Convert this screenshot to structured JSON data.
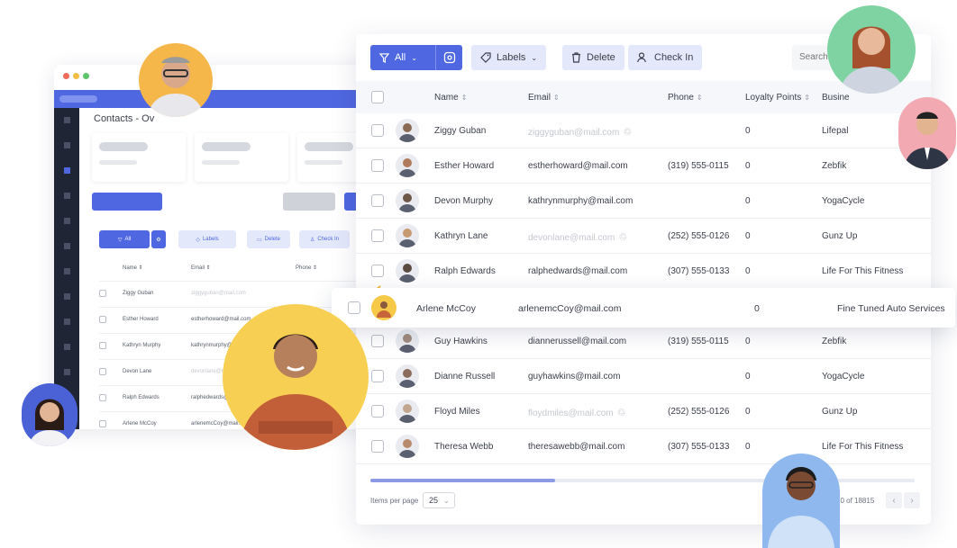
{
  "back_window": {
    "title": "Contacts - Ov",
    "toolbar": {
      "all_label": "All",
      "labels_label": "Labels",
      "delete_label": "Delete",
      "checkin_label": "Check In"
    },
    "headers": {
      "name": "Name",
      "email": "Email",
      "phone": "Phone"
    },
    "rows": [
      {
        "name": "Ziggy Guban",
        "email": "ziggyguban@mail.com",
        "faded": true
      },
      {
        "name": "Esther Howard",
        "email": "estherhoward@mail.com",
        "faded": false
      },
      {
        "name": "Kathryn Murphy",
        "email": "kathrynmurphy@mail.com",
        "faded": false
      },
      {
        "name": "Devon Lane",
        "email": "devonlane@mail.com",
        "faded": true
      },
      {
        "name": "Ralph Edwards",
        "email": "ralphedwards@mail.com",
        "faded": false
      },
      {
        "name": "Arlene McCoy",
        "email": "arlenemcCoy@mail.com",
        "faded": false
      }
    ]
  },
  "toolbar": {
    "all_label": "All",
    "labels_label": "Labels",
    "delete_label": "Delete",
    "checkin_label": "Check In",
    "search_placeholder": "Search"
  },
  "table": {
    "headers": {
      "name": "Name",
      "email": "Email",
      "phone": "Phone",
      "loyalty": "Loyalty Points",
      "business": "Busine"
    },
    "rows": [
      {
        "name": "Ziggy Guban",
        "email": "ziggyguban@mail.com",
        "email_faded": true,
        "phone": "",
        "points": "0",
        "business": "Lifepal",
        "avatar_color": "#8a6a55"
      },
      {
        "name": "Esther Howard",
        "email": "estherhoward@mail.com",
        "email_faded": false,
        "phone": "(319) 555-0115",
        "points": "0",
        "business": "Zebfik",
        "avatar_color": "#b07b5c"
      },
      {
        "name": "Devon Murphy",
        "email": "kathrynmurphy@mail.com",
        "email_faded": false,
        "phone": "",
        "points": "0",
        "business": "YogaCycle",
        "avatar_color": "#6e5747"
      },
      {
        "name": "Kathryn Lane",
        "email": "devonlane@mail.com",
        "email_faded": true,
        "phone": "(252) 555-0126",
        "points": "0",
        "business": "Gunz Up",
        "avatar_color": "#c79a72"
      },
      {
        "name": "Ralph Edwards",
        "email": "ralphedwards@mail.com",
        "email_faded": false,
        "phone": "(307) 555-0133",
        "points": "0",
        "business": "Life For This Fitness",
        "avatar_color": "#5a4a40"
      },
      {
        "name": "Guy Hawkins",
        "email": "diannerussell@mail.com",
        "email_faded": false,
        "phone": "(319) 555-0115",
        "points": "0",
        "business": "Zebfik",
        "avatar_color": "#a08a7c"
      },
      {
        "name": "Dianne Russell",
        "email": "guyhawkins@mail.com",
        "email_faded": false,
        "phone": "",
        "points": "0",
        "business": "YogaCycle",
        "avatar_color": "#8b6b5a"
      },
      {
        "name": "Floyd Miles",
        "email": "floydmiles@mail.com",
        "email_faded": true,
        "phone": "(252) 555-0126",
        "points": "0",
        "business": "Gunz Up",
        "avatar_color": "#c2a58f"
      },
      {
        "name": "Theresa Webb",
        "email": "theresawebb@mail.com",
        "email_faded": false,
        "phone": "(307) 555-0133",
        "points": "0",
        "business": "Life For This Fitness",
        "avatar_color": "#b88a6e"
      }
    ]
  },
  "highlight_row": {
    "name": "Arlene McCoy",
    "email": "arlenemcCoy@mail.com",
    "points": "0",
    "business": "Fine Tuned Auto Services"
  },
  "footer": {
    "items_per_page_label": "Items per page",
    "per_page_value": "25",
    "count_text": "50 of 18815",
    "scroll_fraction": 0.34
  },
  "colors": {
    "accent": "#4f67e0",
    "accent_light": "#e4e8fb",
    "highlight_yellow": "#f7c948"
  }
}
